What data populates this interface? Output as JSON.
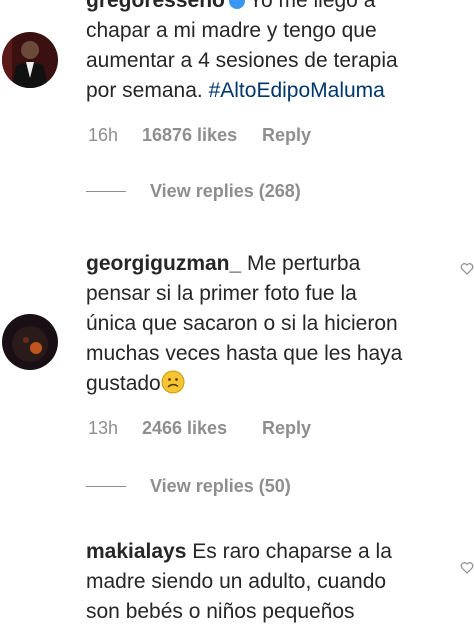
{
  "comments": [
    {
      "username": "gregoresseno",
      "text_line0": "Yo me llegó a",
      "text_line1": "chapar a mi madre y tengo que",
      "text_line2": "aumentar a 4 sesiones de terapia",
      "text_line3": "por semana.",
      "hashtag": "#AltoEdipoMaluma",
      "time": "16h",
      "likes": "16876 likes",
      "reply": "Reply",
      "view_replies": "View replies (268)"
    },
    {
      "username": "georgiguzman_",
      "text_line0_rest": "Me perturba",
      "text_line1": "pensar si la primer foto fue la",
      "text_line2": "única que sacaron o si la hicieron",
      "text_line3": "muchas veces hasta que les haya",
      "text_line4": "gustado",
      "emoji": "confused-face",
      "time": "13h",
      "likes": "2466 likes",
      "reply": "Reply",
      "view_replies": "View replies (50)"
    },
    {
      "username": "makialays",
      "text_line0_rest": "Es raro chaparse a la",
      "text_line1": "madre siendo un adulto, cuando",
      "text_line2": "son bebés o niños pequeños"
    }
  ],
  "colors": {
    "text": "#262626",
    "meta": "#8e8e8e",
    "hashtag": "#00376b",
    "verified": "#3897f0"
  }
}
